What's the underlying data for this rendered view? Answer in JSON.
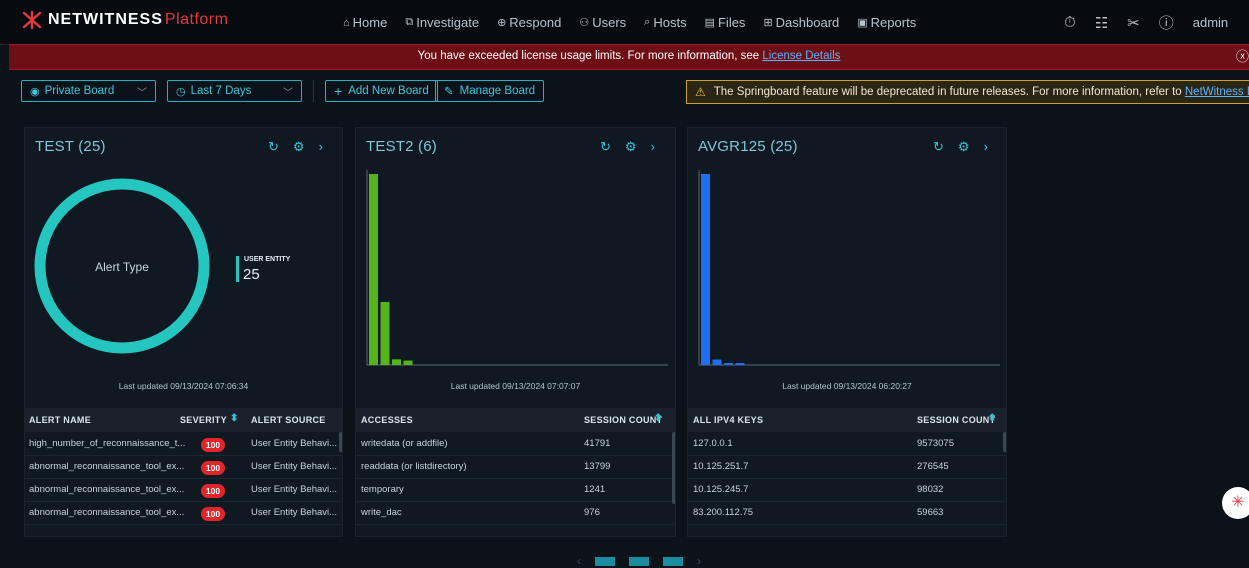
{
  "brand": {
    "name": "NETWITNESS",
    "product": "Platform"
  },
  "nav": [
    {
      "icon": "⌂",
      "icon_name": "home-icon",
      "label": "Home"
    },
    {
      "icon": "⧉",
      "icon_name": "investigate-icon",
      "label": "Investigate"
    },
    {
      "icon": "⊕",
      "icon_name": "respond-icon",
      "label": "Respond"
    },
    {
      "icon": "⚇",
      "icon_name": "users-icon",
      "label": "Users"
    },
    {
      "icon": "⌕",
      "icon_name": "hosts-icon",
      "label": "Hosts"
    },
    {
      "icon": "▤",
      "icon_name": "files-icon",
      "label": "Files"
    },
    {
      "icon": "⊞",
      "icon_name": "dashboard-icon",
      "label": "Dashboard"
    },
    {
      "icon": "▣",
      "icon_name": "reports-icon",
      "label": "Reports"
    }
  ],
  "user": {
    "label": "admin"
  },
  "license_banner": {
    "text": "You have exceeded license usage limits. For more information, see ",
    "link": "License Details"
  },
  "toolbar": {
    "board_select": "Private Board",
    "range_select": "Last 7 Days",
    "add_board": "Add New Board",
    "manage_board": "Manage Board",
    "warning_text": "The Springboard feature will be deprecated in future releases. For more information, refer to ",
    "warning_link": "NetWitness Documentation"
  },
  "panels": {
    "test": {
      "title": "TEST (25)",
      "updated": "Last updated 09/13/2024 07:06:34",
      "donut_center": "Alert Type",
      "legend_label": "USER ENTITY",
      "legend_value": "25",
      "headers": [
        "ALERT NAME",
        "SEVERITY",
        "ALERT SOURCE"
      ],
      "rows": [
        {
          "name": "high_number_of_reconnaissance_t...",
          "severity": "100",
          "source": "User Entity Behavi..."
        },
        {
          "name": "abnormal_reconnaissance_tool_ex...",
          "severity": "100",
          "source": "User Entity Behavi..."
        },
        {
          "name": "abnormal_reconnaissance_tool_ex...",
          "severity": "100",
          "source": "User Entity Behavi..."
        },
        {
          "name": "abnormal_reconnaissance_tool_ex...",
          "severity": "100",
          "source": "User Entity Behavi..."
        }
      ]
    },
    "test2": {
      "title": "TEST2 (6)",
      "updated": "Last updated 09/13/2024 07:07:07",
      "headers": [
        "ACCESSES",
        "SESSION COUNT"
      ],
      "rows": [
        {
          "name": "writedata (or addfile)",
          "count": "41791"
        },
        {
          "name": "readdata (or listdirectory)",
          "count": "13799"
        },
        {
          "name": "temporary",
          "count": "1241"
        },
        {
          "name": "write_dac",
          "count": "976"
        }
      ]
    },
    "avgr": {
      "title": "AVGR125 (25)",
      "updated": "Last updated 09/13/2024 06:20:27",
      "headers": [
        "ALL IPV4 KEYS",
        "SESSION COUNT"
      ],
      "rows": [
        {
          "name": "127.0.0.1",
          "count": "9573075"
        },
        {
          "name": "10.125.251.7",
          "count": "276545"
        },
        {
          "name": "10.125.245.7",
          "count": "98032"
        },
        {
          "name": "83.200.112.75",
          "count": "59663"
        }
      ]
    }
  },
  "colors": {
    "accent": "#1fb2c3",
    "donut": "#26c6c0",
    "test2_bars": "#56b31a",
    "avgr_bars": "#1d6ef0",
    "severity_badge": "#e1262b",
    "license_bg": "#6d0f14",
    "warning_border": "#c9a227"
  },
  "chart_data": [
    {
      "type": "pie",
      "title": "Alert Type",
      "categories": [
        "USER ENTITY"
      ],
      "values": [
        25
      ],
      "legend": "right"
    },
    {
      "type": "bar",
      "categories": [
        "writedata (or addfile)",
        "readdata (or listdirectory)",
        "temporary",
        "write_dac",
        "",
        ""
      ],
      "values": [
        41791,
        13799,
        1241,
        976,
        0,
        0
      ]
    },
    {
      "type": "bar",
      "categories": [
        "127.0.0.1",
        "10.125.251.7",
        "10.125.245.7",
        "83.200.112.75"
      ],
      "values": [
        9573075,
        276545,
        98032,
        59663
      ]
    }
  ]
}
